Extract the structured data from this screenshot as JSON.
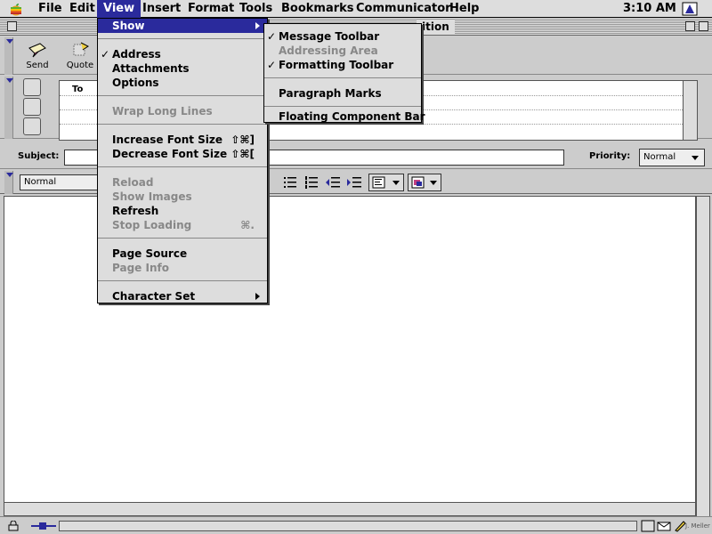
{
  "menubar": {
    "items": [
      "File",
      "Edit",
      "View",
      "Insert",
      "Format",
      "Tools",
      "Bookmarks",
      "Communicator",
      "Help"
    ],
    "clock": "3:10 AM"
  },
  "window": {
    "title_visible": "ition"
  },
  "msg_toolbar": {
    "send_label": "Send",
    "quote_label": "Quote"
  },
  "address": {
    "to_label": "To"
  },
  "subject": {
    "label": "Subject:",
    "value": "",
    "priority_label": "Priority:",
    "priority_value": "Normal"
  },
  "format_toolbar": {
    "style_value": "Normal"
  },
  "view_menu": {
    "items": [
      {
        "label": "Show",
        "highlighted": true,
        "submenu": true
      },
      {
        "label": "Address",
        "checked": true
      },
      {
        "label": "Attachments"
      },
      {
        "label": "Options"
      },
      {
        "label": "Wrap Long Lines",
        "disabled": true
      },
      {
        "label": "Increase Font Size",
        "shortcut": "⇧⌘]"
      },
      {
        "label": "Decrease Font Size",
        "shortcut": "⇧⌘["
      },
      {
        "label": "Reload",
        "disabled": true
      },
      {
        "label": "Show Images",
        "disabled": true
      },
      {
        "label": "Refresh"
      },
      {
        "label": "Stop Loading",
        "disabled": true,
        "shortcut": "⌘."
      },
      {
        "label": "Page Source"
      },
      {
        "label": "Page Info",
        "disabled": true
      },
      {
        "label": "Character Set",
        "submenu": true
      }
    ]
  },
  "show_menu": {
    "items": [
      {
        "label": "Message Toolbar",
        "checked": true
      },
      {
        "label": "Addressing Area",
        "disabled": true
      },
      {
        "label": "Formatting Toolbar",
        "checked": true
      },
      {
        "label": "Paragraph Marks"
      },
      {
        "label": "Floating Component Bar"
      }
    ]
  },
  "status": {
    "watermark": "J. Meller"
  },
  "colors": {
    "highlight": "#2a2a9c",
    "chrome": "#cccccc",
    "disabled_text": "#888888"
  }
}
